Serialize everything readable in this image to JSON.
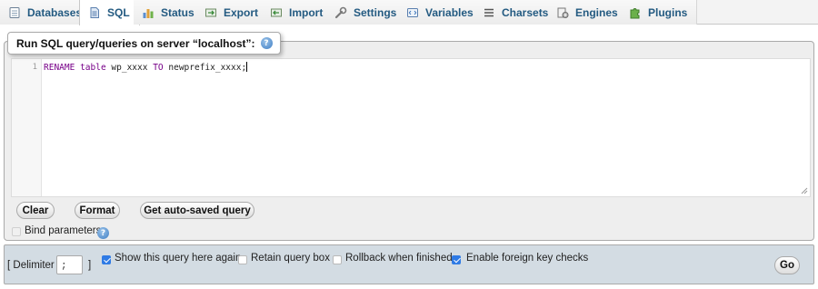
{
  "tabs": [
    {
      "label": "Databases",
      "icon": "database-icon"
    },
    {
      "label": "SQL",
      "icon": "sql-document-icon",
      "active": true
    },
    {
      "label": "Status",
      "icon": "status-chart-icon"
    },
    {
      "label": "Export",
      "icon": "export-icon"
    },
    {
      "label": "Import",
      "icon": "import-icon"
    },
    {
      "label": "Settings",
      "icon": "wrench-icon"
    },
    {
      "label": "Variables",
      "icon": "variables-icon"
    },
    {
      "label": "Charsets",
      "icon": "charsets-list-icon"
    },
    {
      "label": "Engines",
      "icon": "engines-icon"
    },
    {
      "label": "Plugins",
      "icon": "puzzle-piece-icon"
    }
  ],
  "query_panel": {
    "legend": "Run SQL query/queries on server “localhost”:",
    "line_number": "1",
    "query_tokens": {
      "kw1": "RENAME",
      "kw2": "table",
      "name1": "wp_xxxx",
      "kw3": "TO",
      "name2": "newprefix_xxxx;"
    },
    "buttons": {
      "clear": "Clear",
      "format": "Format",
      "autosaved": "Get auto-saved query"
    },
    "bind_parameters": {
      "label": "Bind parameters",
      "checked": false
    }
  },
  "options_bar": {
    "delimiter_label": "[ Delimiter",
    "delimiter_value": ";",
    "delimiter_close": "]",
    "show_query_again": {
      "label": "Show this query here again",
      "checked": true
    },
    "retain_query_box": {
      "label": "Retain query box",
      "checked": false
    },
    "rollback": {
      "label": "Rollback when finished",
      "checked": false
    },
    "foreign_key_checks": {
      "label": "Enable foreign key checks",
      "checked": true
    },
    "go": "Go"
  },
  "colors": {
    "tab_text": "#235a81",
    "keyword": "#770088",
    "checkbox_on": "#2f7be5",
    "bottom_bar": "#d3dce3"
  }
}
